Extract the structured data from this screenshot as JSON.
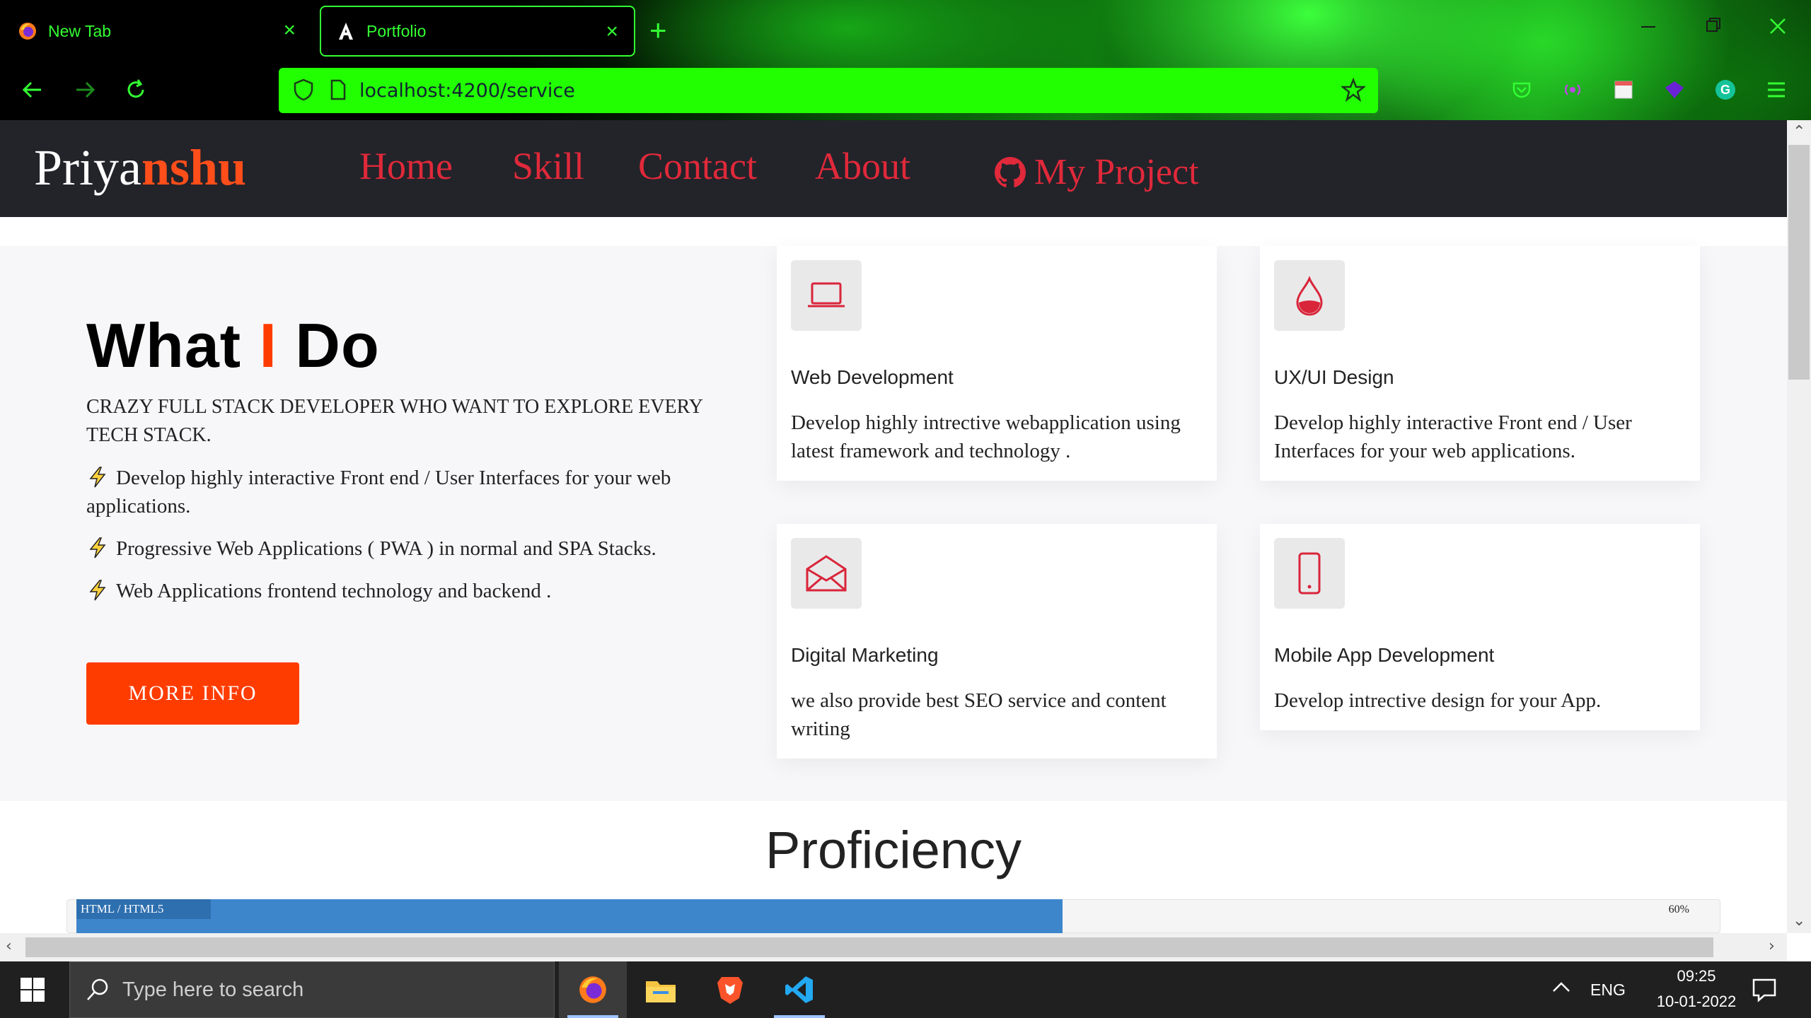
{
  "browser": {
    "tabs": [
      {
        "title": "New Tab",
        "active": false
      },
      {
        "title": "Portfolio",
        "active": true
      }
    ],
    "url": "localhost:4200/service",
    "accent_color": "#33ff33",
    "urlbar_color": "#22ff00"
  },
  "site": {
    "brand_prefix": "Priya",
    "brand_suffix": "nshu",
    "nav": [
      {
        "label": "Home"
      },
      {
        "label": "Skill"
      },
      {
        "label": "Contact"
      },
      {
        "label": "About"
      }
    ],
    "project_link": "My Project",
    "accent_color": "#e0293a",
    "brand_accent": "#ff4e1a"
  },
  "hero": {
    "title_start": "What",
    "title_mid": "I",
    "title_end": "Do",
    "subtitle": "CRAZY FULL STACK DEVELOPER WHO WANT TO EXPLORE EVERY TECH STACK.",
    "bullets": [
      "Develop highly interactive Front end / User Interfaces for your web applications.",
      "Progressive Web Applications ( PWA ) in normal and SPA Stacks.",
      "Web Applications frontend technology and backend ."
    ],
    "button_label": "MORE INFO"
  },
  "cards": [
    {
      "icon": "laptop-icon",
      "title": "Web Development",
      "desc": "Develop highly intrective webapplication using latest framework and technology ."
    },
    {
      "icon": "droplet-icon",
      "title": "UX/UI Design",
      "desc": "Develop highly interactive Front end / User Interfaces for your web applications."
    },
    {
      "icon": "envelope-icon",
      "title": "Digital Marketing",
      "desc": "we also provide best SEO service and content writing"
    },
    {
      "icon": "mobile-icon",
      "title": "Mobile App Development",
      "desc": "Develop intrective design for your App."
    }
  ],
  "proficiency": {
    "title": "Proficiency",
    "skills": [
      {
        "name": "HTML / HTML5",
        "percent": 60,
        "percent_label": "60%"
      }
    ]
  },
  "taskbar": {
    "search_placeholder": "Type here to search",
    "language": "ENG",
    "time": "09:25",
    "date": "10-01-2022"
  }
}
